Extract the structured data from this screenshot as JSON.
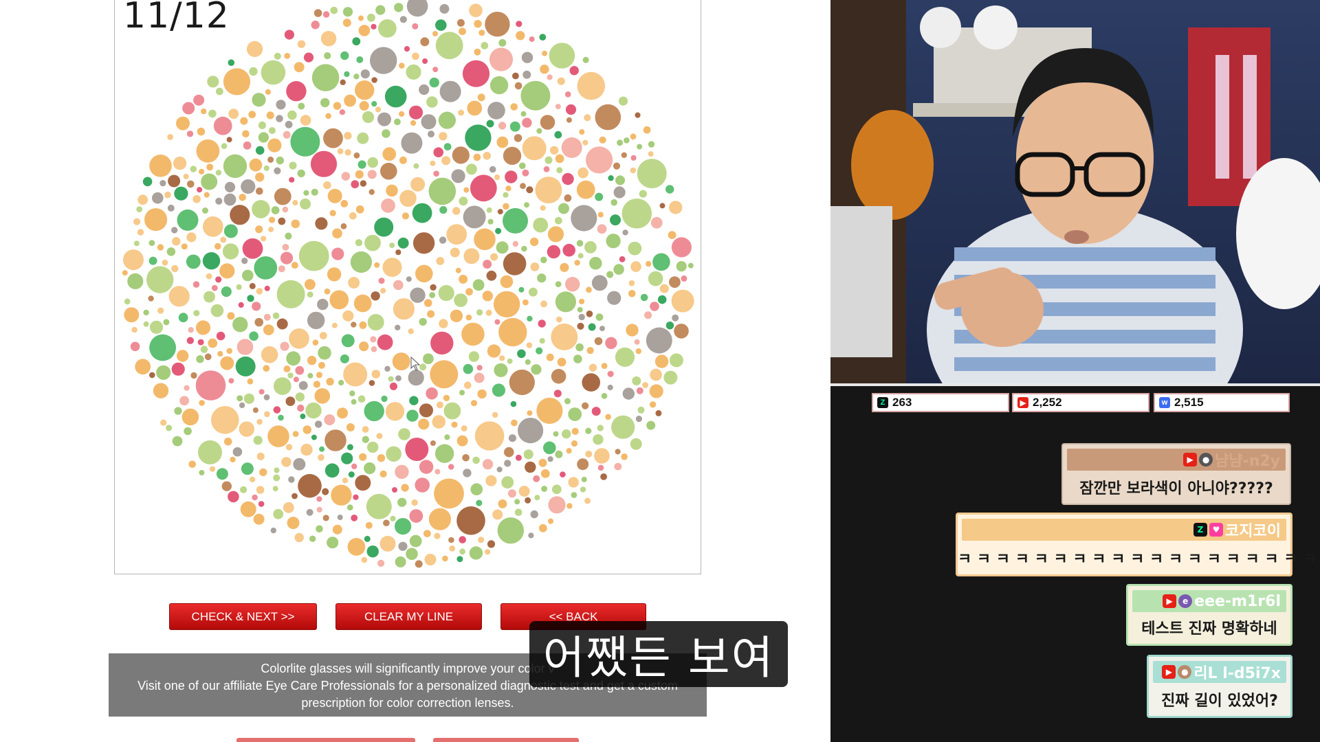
{
  "plate": {
    "counter": "11/12"
  },
  "buttons": {
    "check_next": "CHECK & NEXT >>",
    "clear_line": "CLEAR MY LINE",
    "back": "<< BACK"
  },
  "info": {
    "line1": "Colorlite glasses will significantly improve your color v",
    "line2": "Visit one of our affiliate Eye Care Professionals for a personalized diagnostic test and get a custom",
    "line3": "prescription for color correction lenses."
  },
  "subtitle": "어쨌든 보여",
  "counters": {
    "chzzk": "263",
    "youtube": "2,252",
    "other": "2,515"
  },
  "chat": [
    {
      "user": "냠냠-n2y",
      "message": "잠깐만 보라색이 아니야?????"
    },
    {
      "user": "코지코이",
      "message": "ㅋ ㅋ ㅋ ㅋ ㅋ ㅋ ㅋ ㅋ ㅋ ㅋ ㅋ ㅋ ㅋ ㅋ ㅋ ㅋ ㅋ ㅋ ㅋ"
    },
    {
      "user": "eee-m1r6l",
      "message": "테스트 진짜 명확하네"
    },
    {
      "user": "리L l-d5i7x",
      "message": "진짜 길이 있었어?"
    }
  ],
  "colors": {
    "button_red": "#d11c1c",
    "info_gray": "#7a7a7a",
    "plate_palette": [
      "#f3b96a",
      "#f7c98a",
      "#bcd78a",
      "#a5cc7a",
      "#5fbf73",
      "#3aa860",
      "#e35a79",
      "#ee8c96",
      "#a9a19c",
      "#c28b5e",
      "#a86a45",
      "#f4b2a8"
    ]
  }
}
